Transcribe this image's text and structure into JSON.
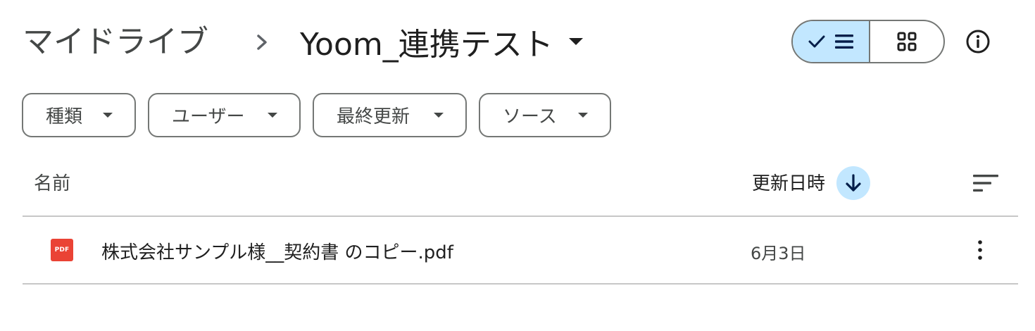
{
  "breadcrumb": {
    "root": "マイドライブ",
    "current": "Yoom_連携テスト"
  },
  "view_toggle": {
    "list_selected": true,
    "grid_selected": false
  },
  "filters": [
    {
      "label": "種類"
    },
    {
      "label": "ユーザー"
    },
    {
      "label": "最終更新"
    },
    {
      "label": "ソース"
    }
  ],
  "list_header": {
    "name": "名前",
    "modified": "更新日時",
    "sort_direction": "descending"
  },
  "files": [
    {
      "icon": "pdf-icon",
      "type_label": "PDF",
      "name": "株式会社サンプル様__契約書 のコピー.pdf",
      "modified": "6月3日"
    }
  ],
  "colors": {
    "accent_selected": "#c2e7ff",
    "sort_arrow": "#041e49",
    "pdf_red": "#ea4335",
    "outline": "#747775",
    "divider": "#c7c7c7",
    "text_primary": "#1f1f1f",
    "text_secondary": "#444746"
  }
}
